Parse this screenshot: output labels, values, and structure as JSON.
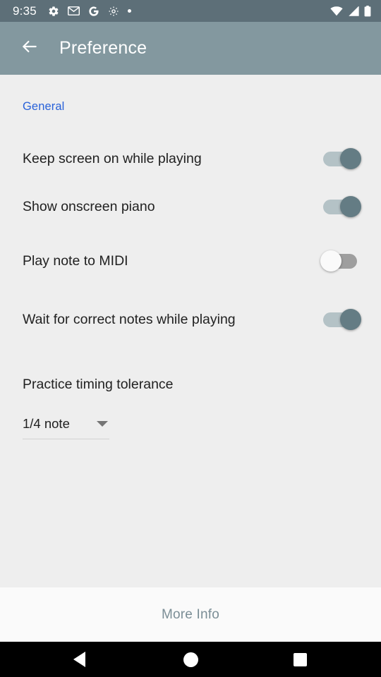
{
  "status_bar": {
    "time": "9:35",
    "left_icons": [
      "gear-icon",
      "gmail-icon",
      "google-icon",
      "gear-icon",
      "dot-icon"
    ],
    "right_icons": [
      "wifi-icon",
      "cell-signal-icon",
      "battery-icon"
    ],
    "background": "#5d6f78"
  },
  "app_bar": {
    "back_icon": "arrow-back-icon",
    "title": "Preference",
    "background": "#83989f"
  },
  "content": {
    "background": "#eeeeee",
    "section_header": "General",
    "section_header_color": "#2962d9",
    "preferences": [
      {
        "label": "Keep screen on while playing",
        "state": "on"
      },
      {
        "label": "Show onscreen piano",
        "state": "on"
      },
      {
        "label": "Play note to MIDI",
        "state": "off"
      },
      {
        "label": "Wait for correct notes while playing",
        "state": "on"
      }
    ],
    "spinner": {
      "label": "Practice timing tolerance",
      "value": "1/4 note",
      "caret_icon": "chevron-down-icon"
    },
    "switch_colors": {
      "on_track": "#b4c2c6",
      "on_thumb": "#647c84",
      "off_track": "#9e9e9e",
      "off_thumb": "#fafafa"
    }
  },
  "footer": {
    "label": "More Info",
    "color": "#7b8e96",
    "background": "#fafafa"
  },
  "nav_bar": {
    "background": "#000000",
    "back_label": "back-button",
    "home_label": "home-button",
    "recents_label": "recents-button"
  }
}
